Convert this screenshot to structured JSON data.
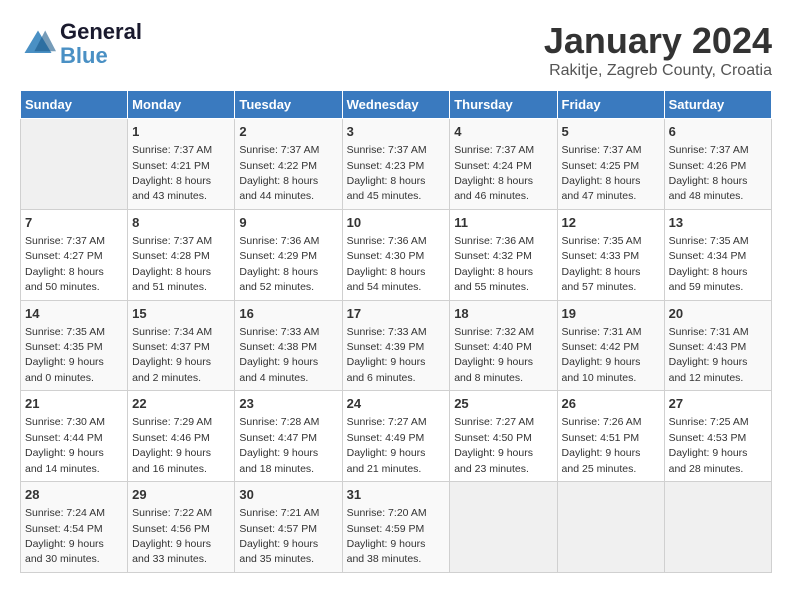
{
  "logo": {
    "line1": "General",
    "line2": "Blue"
  },
  "title": "January 2024",
  "location": "Rakitje, Zagreb County, Croatia",
  "days_of_week": [
    "Sunday",
    "Monday",
    "Tuesday",
    "Wednesday",
    "Thursday",
    "Friday",
    "Saturday"
  ],
  "weeks": [
    [
      {
        "num": "",
        "sunrise": "",
        "sunset": "",
        "daylight": ""
      },
      {
        "num": "1",
        "sunrise": "Sunrise: 7:37 AM",
        "sunset": "Sunset: 4:21 PM",
        "daylight": "Daylight: 8 hours and 43 minutes."
      },
      {
        "num": "2",
        "sunrise": "Sunrise: 7:37 AM",
        "sunset": "Sunset: 4:22 PM",
        "daylight": "Daylight: 8 hours and 44 minutes."
      },
      {
        "num": "3",
        "sunrise": "Sunrise: 7:37 AM",
        "sunset": "Sunset: 4:23 PM",
        "daylight": "Daylight: 8 hours and 45 minutes."
      },
      {
        "num": "4",
        "sunrise": "Sunrise: 7:37 AM",
        "sunset": "Sunset: 4:24 PM",
        "daylight": "Daylight: 8 hours and 46 minutes."
      },
      {
        "num": "5",
        "sunrise": "Sunrise: 7:37 AM",
        "sunset": "Sunset: 4:25 PM",
        "daylight": "Daylight: 8 hours and 47 minutes."
      },
      {
        "num": "6",
        "sunrise": "Sunrise: 7:37 AM",
        "sunset": "Sunset: 4:26 PM",
        "daylight": "Daylight: 8 hours and 48 minutes."
      }
    ],
    [
      {
        "num": "7",
        "sunrise": "Sunrise: 7:37 AM",
        "sunset": "Sunset: 4:27 PM",
        "daylight": "Daylight: 8 hours and 50 minutes."
      },
      {
        "num": "8",
        "sunrise": "Sunrise: 7:37 AM",
        "sunset": "Sunset: 4:28 PM",
        "daylight": "Daylight: 8 hours and 51 minutes."
      },
      {
        "num": "9",
        "sunrise": "Sunrise: 7:36 AM",
        "sunset": "Sunset: 4:29 PM",
        "daylight": "Daylight: 8 hours and 52 minutes."
      },
      {
        "num": "10",
        "sunrise": "Sunrise: 7:36 AM",
        "sunset": "Sunset: 4:30 PM",
        "daylight": "Daylight: 8 hours and 54 minutes."
      },
      {
        "num": "11",
        "sunrise": "Sunrise: 7:36 AM",
        "sunset": "Sunset: 4:32 PM",
        "daylight": "Daylight: 8 hours and 55 minutes."
      },
      {
        "num": "12",
        "sunrise": "Sunrise: 7:35 AM",
        "sunset": "Sunset: 4:33 PM",
        "daylight": "Daylight: 8 hours and 57 minutes."
      },
      {
        "num": "13",
        "sunrise": "Sunrise: 7:35 AM",
        "sunset": "Sunset: 4:34 PM",
        "daylight": "Daylight: 8 hours and 59 minutes."
      }
    ],
    [
      {
        "num": "14",
        "sunrise": "Sunrise: 7:35 AM",
        "sunset": "Sunset: 4:35 PM",
        "daylight": "Daylight: 9 hours and 0 minutes."
      },
      {
        "num": "15",
        "sunrise": "Sunrise: 7:34 AM",
        "sunset": "Sunset: 4:37 PM",
        "daylight": "Daylight: 9 hours and 2 minutes."
      },
      {
        "num": "16",
        "sunrise": "Sunrise: 7:33 AM",
        "sunset": "Sunset: 4:38 PM",
        "daylight": "Daylight: 9 hours and 4 minutes."
      },
      {
        "num": "17",
        "sunrise": "Sunrise: 7:33 AM",
        "sunset": "Sunset: 4:39 PM",
        "daylight": "Daylight: 9 hours and 6 minutes."
      },
      {
        "num": "18",
        "sunrise": "Sunrise: 7:32 AM",
        "sunset": "Sunset: 4:40 PM",
        "daylight": "Daylight: 9 hours and 8 minutes."
      },
      {
        "num": "19",
        "sunrise": "Sunrise: 7:31 AM",
        "sunset": "Sunset: 4:42 PM",
        "daylight": "Daylight: 9 hours and 10 minutes."
      },
      {
        "num": "20",
        "sunrise": "Sunrise: 7:31 AM",
        "sunset": "Sunset: 4:43 PM",
        "daylight": "Daylight: 9 hours and 12 minutes."
      }
    ],
    [
      {
        "num": "21",
        "sunrise": "Sunrise: 7:30 AM",
        "sunset": "Sunset: 4:44 PM",
        "daylight": "Daylight: 9 hours and 14 minutes."
      },
      {
        "num": "22",
        "sunrise": "Sunrise: 7:29 AM",
        "sunset": "Sunset: 4:46 PM",
        "daylight": "Daylight: 9 hours and 16 minutes."
      },
      {
        "num": "23",
        "sunrise": "Sunrise: 7:28 AM",
        "sunset": "Sunset: 4:47 PM",
        "daylight": "Daylight: 9 hours and 18 minutes."
      },
      {
        "num": "24",
        "sunrise": "Sunrise: 7:27 AM",
        "sunset": "Sunset: 4:49 PM",
        "daylight": "Daylight: 9 hours and 21 minutes."
      },
      {
        "num": "25",
        "sunrise": "Sunrise: 7:27 AM",
        "sunset": "Sunset: 4:50 PM",
        "daylight": "Daylight: 9 hours and 23 minutes."
      },
      {
        "num": "26",
        "sunrise": "Sunrise: 7:26 AM",
        "sunset": "Sunset: 4:51 PM",
        "daylight": "Daylight: 9 hours and 25 minutes."
      },
      {
        "num": "27",
        "sunrise": "Sunrise: 7:25 AM",
        "sunset": "Sunset: 4:53 PM",
        "daylight": "Daylight: 9 hours and 28 minutes."
      }
    ],
    [
      {
        "num": "28",
        "sunrise": "Sunrise: 7:24 AM",
        "sunset": "Sunset: 4:54 PM",
        "daylight": "Daylight: 9 hours and 30 minutes."
      },
      {
        "num": "29",
        "sunrise": "Sunrise: 7:22 AM",
        "sunset": "Sunset: 4:56 PM",
        "daylight": "Daylight: 9 hours and 33 minutes."
      },
      {
        "num": "30",
        "sunrise": "Sunrise: 7:21 AM",
        "sunset": "Sunset: 4:57 PM",
        "daylight": "Daylight: 9 hours and 35 minutes."
      },
      {
        "num": "31",
        "sunrise": "Sunrise: 7:20 AM",
        "sunset": "Sunset: 4:59 PM",
        "daylight": "Daylight: 9 hours and 38 minutes."
      },
      {
        "num": "",
        "sunrise": "",
        "sunset": "",
        "daylight": ""
      },
      {
        "num": "",
        "sunrise": "",
        "sunset": "",
        "daylight": ""
      },
      {
        "num": "",
        "sunrise": "",
        "sunset": "",
        "daylight": ""
      }
    ]
  ]
}
